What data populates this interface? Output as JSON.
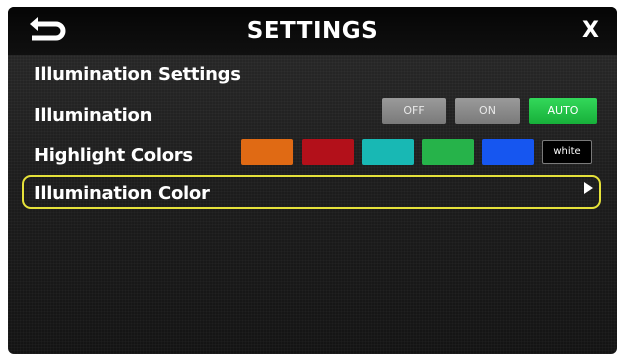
{
  "header": {
    "title": "SETTINGS",
    "close_label": "X",
    "back_icon": "return-arrow-icon"
  },
  "section": {
    "heading": "Illumination Settings"
  },
  "illumination": {
    "label": "Illumination",
    "options": [
      "OFF",
      "ON",
      "AUTO"
    ],
    "selected": "AUTO"
  },
  "highlight_colors": {
    "label": "Highlight Colors",
    "swatches": [
      "#e06a14",
      "#b3101a",
      "#18b8b4",
      "#26b34a",
      "#1656f0"
    ],
    "white_label": "white"
  },
  "illumination_color": {
    "label": "Illumination Color"
  },
  "colors": {
    "auto_active": "#1fc544",
    "highlight_border": "#e6e23a"
  }
}
